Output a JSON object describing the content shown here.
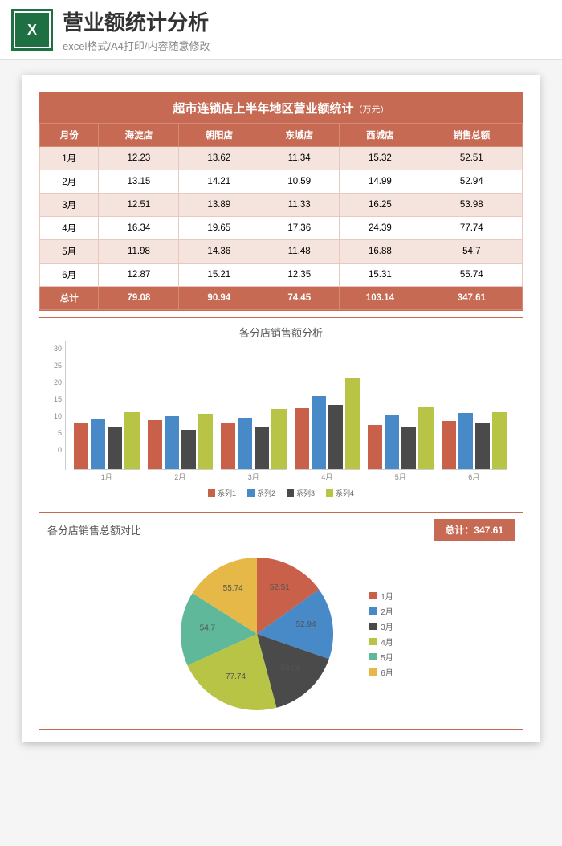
{
  "banner": {
    "title": "营业额统计分析",
    "sub": "excel格式/A4打印/内容随意修改"
  },
  "tableTitle": "超市连锁店上半年地区营业额统计",
  "tableTitleUnit": "（万元）",
  "headers": [
    "月份",
    "海淀店",
    "朝阳店",
    "东城店",
    "西城店",
    "销售总额"
  ],
  "rows": [
    {
      "m": "1月",
      "a": 12.23,
      "b": 13.62,
      "c": 11.34,
      "d": 15.32,
      "t": 52.51
    },
    {
      "m": "2月",
      "a": 13.15,
      "b": 14.21,
      "c": 10.59,
      "d": 14.99,
      "t": 52.94
    },
    {
      "m": "3月",
      "a": 12.51,
      "b": 13.89,
      "c": 11.33,
      "d": 16.25,
      "t": 53.98
    },
    {
      "m": "4月",
      "a": 16.34,
      "b": 19.65,
      "c": 17.36,
      "d": 24.39,
      "t": 77.74
    },
    {
      "m": "5月",
      "a": 11.98,
      "b": 14.36,
      "c": 11.48,
      "d": 16.88,
      "t": 54.7
    },
    {
      "m": "6月",
      "a": 12.87,
      "b": 15.21,
      "c": 12.35,
      "d": 15.31,
      "t": 55.74
    }
  ],
  "totals": {
    "label": "总计",
    "a": 79.08,
    "b": 90.94,
    "c": 74.45,
    "d": 103.14,
    "t": 347.61
  },
  "chart_data": [
    {
      "type": "bar",
      "title": "各分店销售额分析",
      "categories": [
        "1月",
        "2月",
        "3月",
        "4月",
        "5月",
        "6月"
      ],
      "series": [
        {
          "name": "系列1",
          "values": [
            12.23,
            13.15,
            12.51,
            16.34,
            11.98,
            12.87
          ],
          "color": "#c9614a"
        },
        {
          "name": "系列2",
          "values": [
            13.62,
            14.21,
            13.89,
            19.65,
            14.36,
            15.21
          ],
          "color": "#4889c8"
        },
        {
          "name": "系列3",
          "values": [
            11.34,
            10.59,
            11.33,
            17.36,
            11.48,
            12.35
          ],
          "color": "#4a4a4a"
        },
        {
          "name": "系列4",
          "values": [
            15.32,
            14.99,
            16.25,
            24.39,
            16.88,
            15.31
          ],
          "color": "#b8c445"
        }
      ],
      "ylim": [
        0,
        30
      ],
      "yticks": [
        0,
        5,
        10,
        15,
        20,
        25,
        30
      ]
    },
    {
      "type": "pie",
      "title": "各分店销售总额对比",
      "total_label": "总计：",
      "total_value": 347.61,
      "categories": [
        "1月",
        "2月",
        "3月",
        "4月",
        "5月",
        "6月"
      ],
      "values": [
        52.51,
        52.94,
        53.98,
        77.74,
        54.7,
        55.74
      ],
      "colors": [
        "#c9614a",
        "#4889c8",
        "#4a4a4a",
        "#b8c445",
        "#5fb89a",
        "#e6b847"
      ]
    }
  ]
}
